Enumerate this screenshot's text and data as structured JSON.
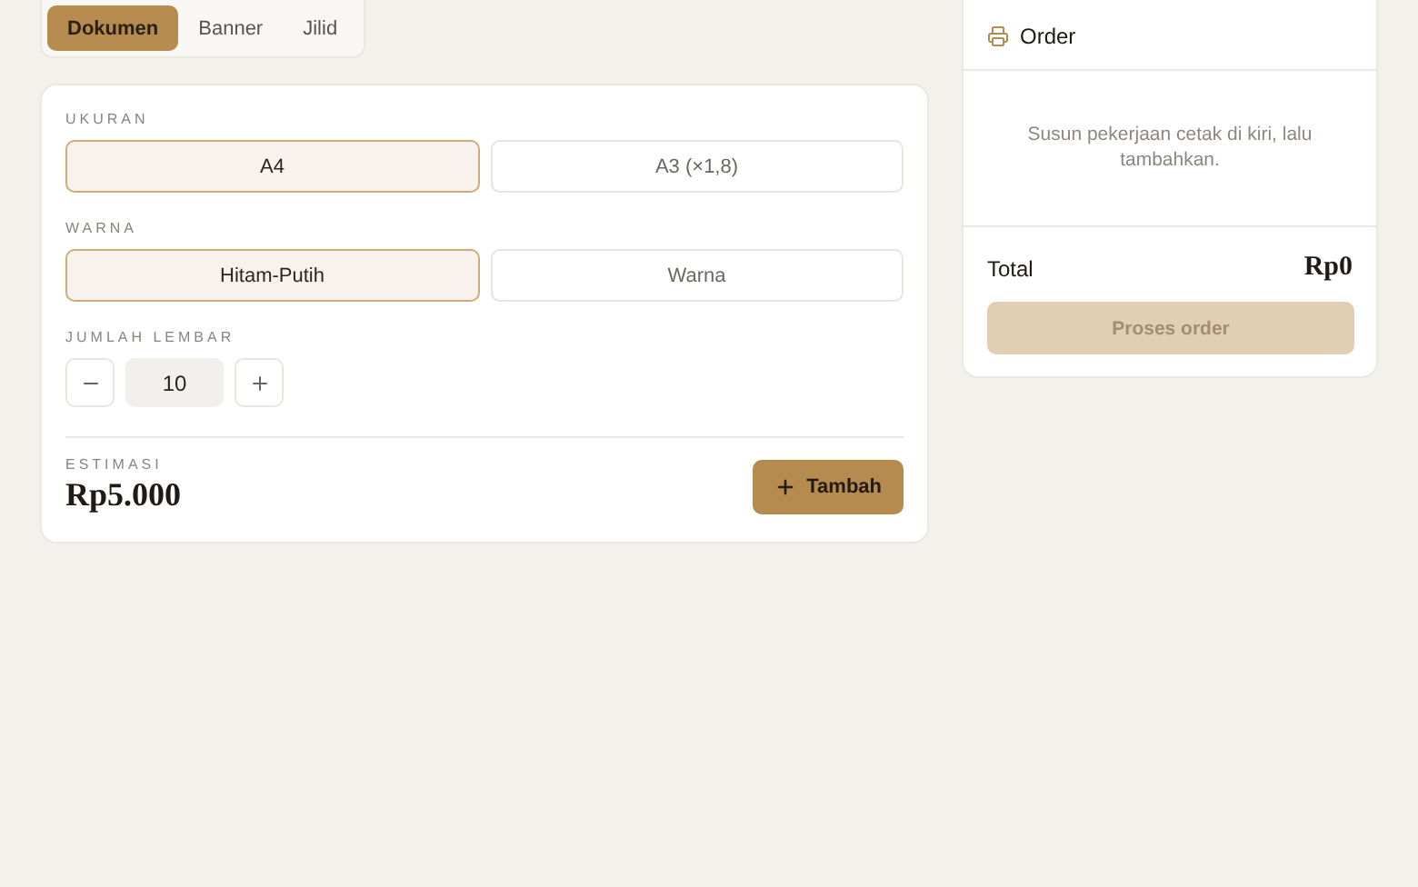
{
  "tabs": [
    {
      "label": "Dokumen",
      "selected": true
    },
    {
      "label": "Banner",
      "selected": false
    },
    {
      "label": "Jilid",
      "selected": false
    }
  ],
  "form": {
    "groups": [
      {
        "label": "UKURAN",
        "options": [
          {
            "label": "A4",
            "selected": true
          },
          {
            "label": "A3 (×1,8)",
            "selected": false
          }
        ]
      },
      {
        "label": "WARNA",
        "options": [
          {
            "label": "Hitam-Putih",
            "selected": true
          },
          {
            "label": "Warna",
            "selected": false
          }
        ]
      }
    ],
    "quantity": {
      "label": "JUMLAH LEMBAR",
      "value": "10"
    },
    "estimate": {
      "label": "ESTIMASI",
      "value": "Rp5.000"
    },
    "add_button": "Tambah"
  },
  "order": {
    "title": "Order",
    "empty_message": "Susun pekerjaan cetak di kiri, lalu tambahkan.",
    "total_label": "Total",
    "total_value": "Rp0",
    "submit": {
      "label": "Proses order",
      "disabled": true
    }
  }
}
